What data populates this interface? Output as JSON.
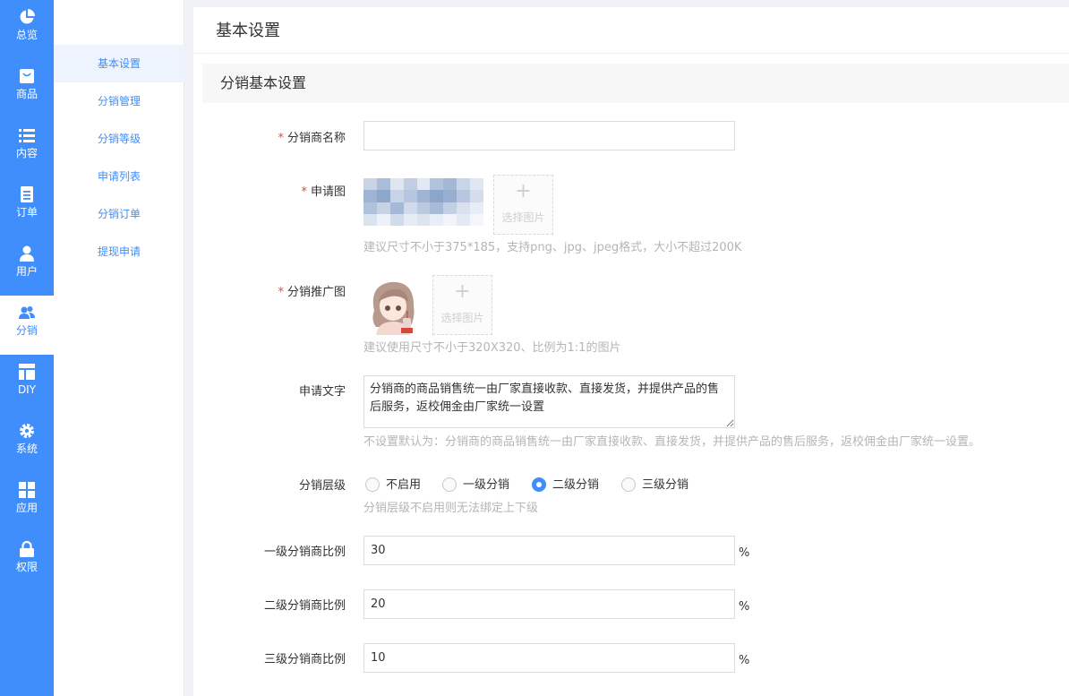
{
  "nav": {
    "items": [
      {
        "label": "总览",
        "icon": "pie-chart-icon"
      },
      {
        "label": "商品",
        "icon": "shopping-bag-icon"
      },
      {
        "label": "内容",
        "icon": "list-icon"
      },
      {
        "label": "订单",
        "icon": "document-icon"
      },
      {
        "label": "用户",
        "icon": "user-icon"
      },
      {
        "label": "分销",
        "icon": "users-icon"
      },
      {
        "label": "DIY",
        "icon": "layout-icon"
      },
      {
        "label": "系统",
        "icon": "gear-icon"
      },
      {
        "label": "应用",
        "icon": "grid-icon"
      },
      {
        "label": "权限",
        "icon": "lock-icon"
      }
    ],
    "active": "分销",
    "color": "#3f8efc"
  },
  "submenu": {
    "items": [
      "基本设置",
      "分销管理",
      "分销等级",
      "申请列表",
      "分销订单",
      "提现申请"
    ],
    "active": "基本设置"
  },
  "page": {
    "title": "基本设置",
    "section_title": "分销基本设置"
  },
  "form": {
    "name": {
      "label": "分销商名称",
      "value": ""
    },
    "apply_image": {
      "label": "申请图",
      "upload_label": "选择图片",
      "hint": "建议尺寸不小于375*185，支持png、jpg、jpeg格式，大小不超过200K"
    },
    "promo_image": {
      "label": "分销推广图",
      "upload_label": "选择图片",
      "hint": "建议使用尺寸不小于320X320、比例为1:1的图片"
    },
    "apply_text": {
      "label": "申请文字",
      "value": "分销商的商品销售统一由厂家直接收款、直接发货，并提供产品的售后服务，返校佣金由厂家统一设置",
      "hint": "不设置默认为：分销商的商品销售统一由厂家直接收款、直接发货，并提供产品的售后服务，返校佣金由厂家统一设置。"
    },
    "level": {
      "label": "分销层级",
      "options": [
        "不启用",
        "一级分销",
        "二级分销",
        "三级分销"
      ],
      "selected": "二级分销",
      "hint": "分销层级不启用则无法绑定上下级"
    },
    "rate1": {
      "label": "一级分销商比例",
      "value": "30",
      "suffix": "%"
    },
    "rate2": {
      "label": "二级分销商比例",
      "value": "20",
      "suffix": "%"
    },
    "rate3": {
      "label": "三级分销商比例",
      "value": "10",
      "suffix": "%"
    },
    "required_mark": "*"
  }
}
